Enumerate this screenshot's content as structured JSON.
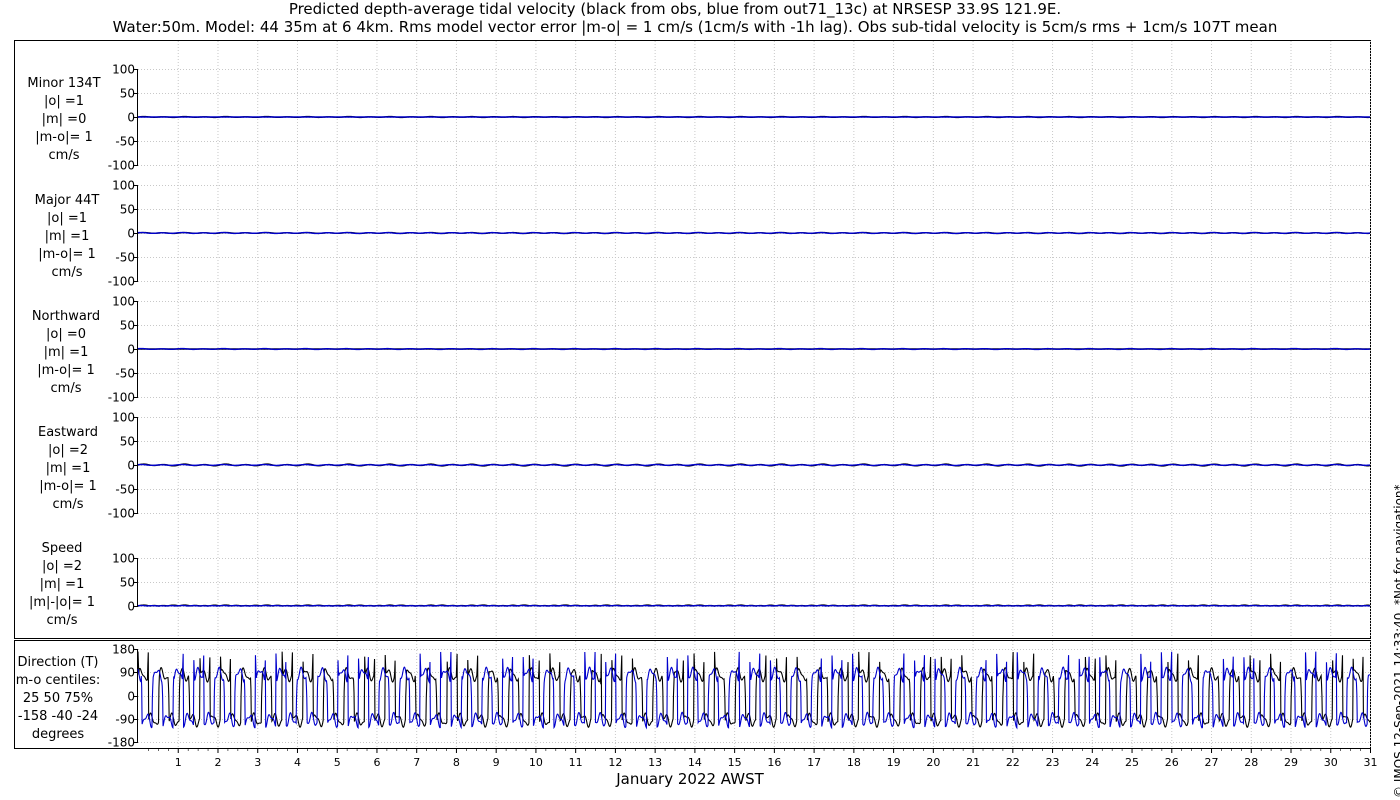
{
  "chart_data": {
    "type": "line",
    "title": "Predicted depth-average tidal velocity (black from obs, blue from out71_13c) at NRSESP 33.9S 121.9E.",
    "subtitle": "Water:50m. Model: 44 35m at 6 4km. Rms model vector error |m-o| = 1 cm/s (1cm/s with -1h lag). Obs sub-tidal velocity is 5cm/s rms + 1cm/s 107T mean",
    "xlabel": "January 2022 AWST",
    "x_ticks": [
      "1",
      "2",
      "3",
      "4",
      "5",
      "6",
      "7",
      "8",
      "9",
      "10",
      "11",
      "12",
      "13",
      "14",
      "15",
      "16",
      "17",
      "18",
      "19",
      "20",
      "21",
      "22",
      "23",
      "24",
      "25",
      "26",
      "27",
      "28",
      "29",
      "30",
      "31"
    ],
    "xlim": [
      0,
      31
    ],
    "grid": true,
    "series_colors": {
      "obs": "#000000",
      "model": "#0000cc"
    },
    "panels": [
      {
        "id": "minor",
        "label": [
          "Minor 134T",
          "|o| =1",
          "|m| =0",
          "|m-o|= 1",
          "cm/s"
        ],
        "ylim": [
          -100,
          100
        ],
        "yticks": [
          "100",
          "50",
          "0",
          "-50",
          "-100"
        ],
        "obs_amp": 1,
        "model_amp": 0
      },
      {
        "id": "major",
        "label": [
          "Major 44T",
          "|o| =1",
          "|m| =1",
          "|m-o|= 1",
          "cm/s"
        ],
        "ylim": [
          -100,
          100
        ],
        "yticks": [
          "100",
          "50",
          "0",
          "-50",
          "-100"
        ],
        "obs_amp": 1,
        "model_amp": 1
      },
      {
        "id": "north",
        "label": [
          "Northward",
          "|o| =0",
          "|m| =1",
          "|m-o|= 1",
          "cm/s"
        ],
        "ylim": [
          -100,
          100
        ],
        "yticks": [
          "100",
          "50",
          "0",
          "-50",
          "-100"
        ],
        "obs_amp": 0,
        "model_amp": 1
      },
      {
        "id": "east",
        "label": [
          "Eastward",
          "|o| =2",
          "|m| =1",
          "|m-o|= 1",
          "cm/s"
        ],
        "ylim": [
          -100,
          100
        ],
        "yticks": [
          "100",
          "50",
          "0",
          "-50",
          "-100"
        ],
        "obs_amp": 2,
        "model_amp": 1
      },
      {
        "id": "speed",
        "label": [
          "Speed",
          "|o| =2",
          "|m| =1",
          "|m|-|o|= 1",
          "cm/s"
        ],
        "ylim": [
          0,
          100
        ],
        "yticks": [
          "100",
          "50",
          "0"
        ],
        "obs_amp": 2,
        "model_amp": 1
      },
      {
        "id": "direction",
        "label": [
          "Direction (T)",
          "m-o centiles:",
          "25  50  75%",
          "-158  -40  -24",
          "degrees"
        ],
        "ylim": [
          -180,
          180
        ],
        "yticks": [
          "180",
          "90",
          "0",
          "-90",
          "-180"
        ]
      }
    ]
  },
  "credit": "© IMOS 12-Sep-2021 14:33:40. *Not for navigation*"
}
